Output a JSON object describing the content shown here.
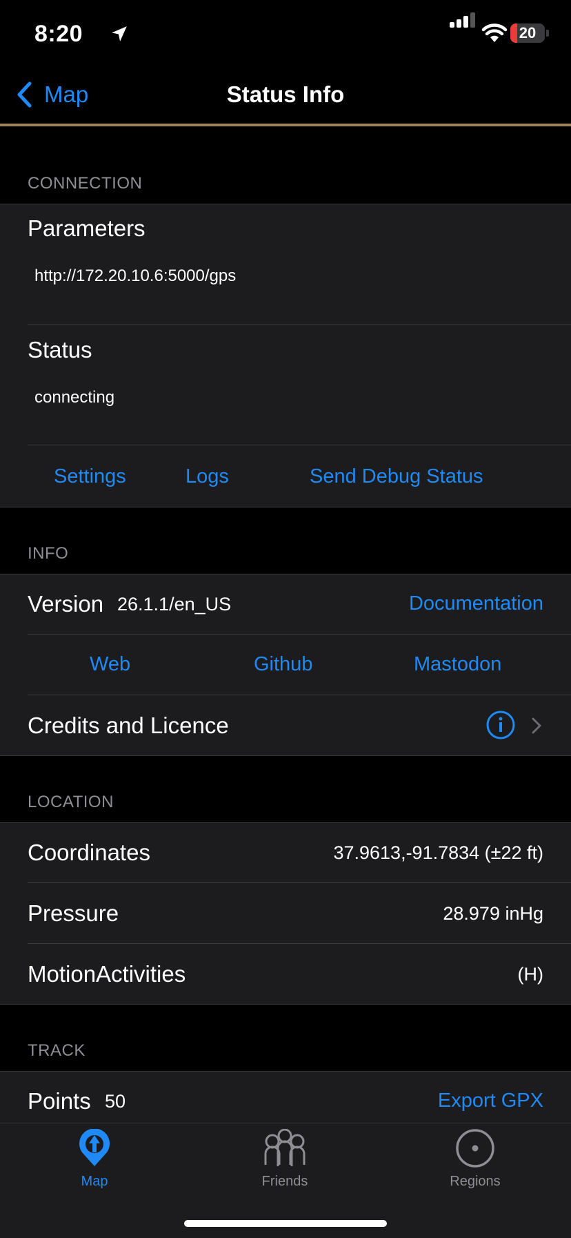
{
  "status_bar": {
    "time": "8:20",
    "battery": "20",
    "battery_level": 0.2,
    "battery_color": "#eb3c3c"
  },
  "nav": {
    "back_label": "Map",
    "title": "Status Info"
  },
  "connection": {
    "header": "CONNECTION",
    "parameters_label": "Parameters",
    "parameters_value": "http://172.20.10.6:5000/gps",
    "status_label": "Status",
    "status_value": "connecting",
    "settings": "Settings",
    "logs": "Logs",
    "send_debug": "Send Debug Status"
  },
  "info": {
    "header": "INFO",
    "version_label": "Version",
    "version_value": "26.1.1/en_US",
    "documentation": "Documentation",
    "web": "Web",
    "github": "Github",
    "mastodon": "Mastodon",
    "credits": "Credits and Licence"
  },
  "location": {
    "header": "LOCATION",
    "coordinates_label": "Coordinates",
    "coordinates_value": "37.9613,-91.7834 (±22 ft)",
    "pressure_label": "Pressure",
    "pressure_value": "28.979 inHg",
    "motion_label": "MotionActivities",
    "motion_value": "(H)"
  },
  "track": {
    "header": "TRACK",
    "points_label": "Points",
    "points_value": "50",
    "export": "Export GPX"
  },
  "tabs": [
    {
      "label": "Map",
      "icon": "map-pin-icon",
      "active": true
    },
    {
      "label": "Friends",
      "icon": "friends-icon",
      "active": false
    },
    {
      "label": "Regions",
      "icon": "regions-icon",
      "active": false
    }
  ],
  "colors": {
    "accent": "#1f8af5",
    "gold": "#9c8654",
    "inactive": "#8e8e93"
  }
}
